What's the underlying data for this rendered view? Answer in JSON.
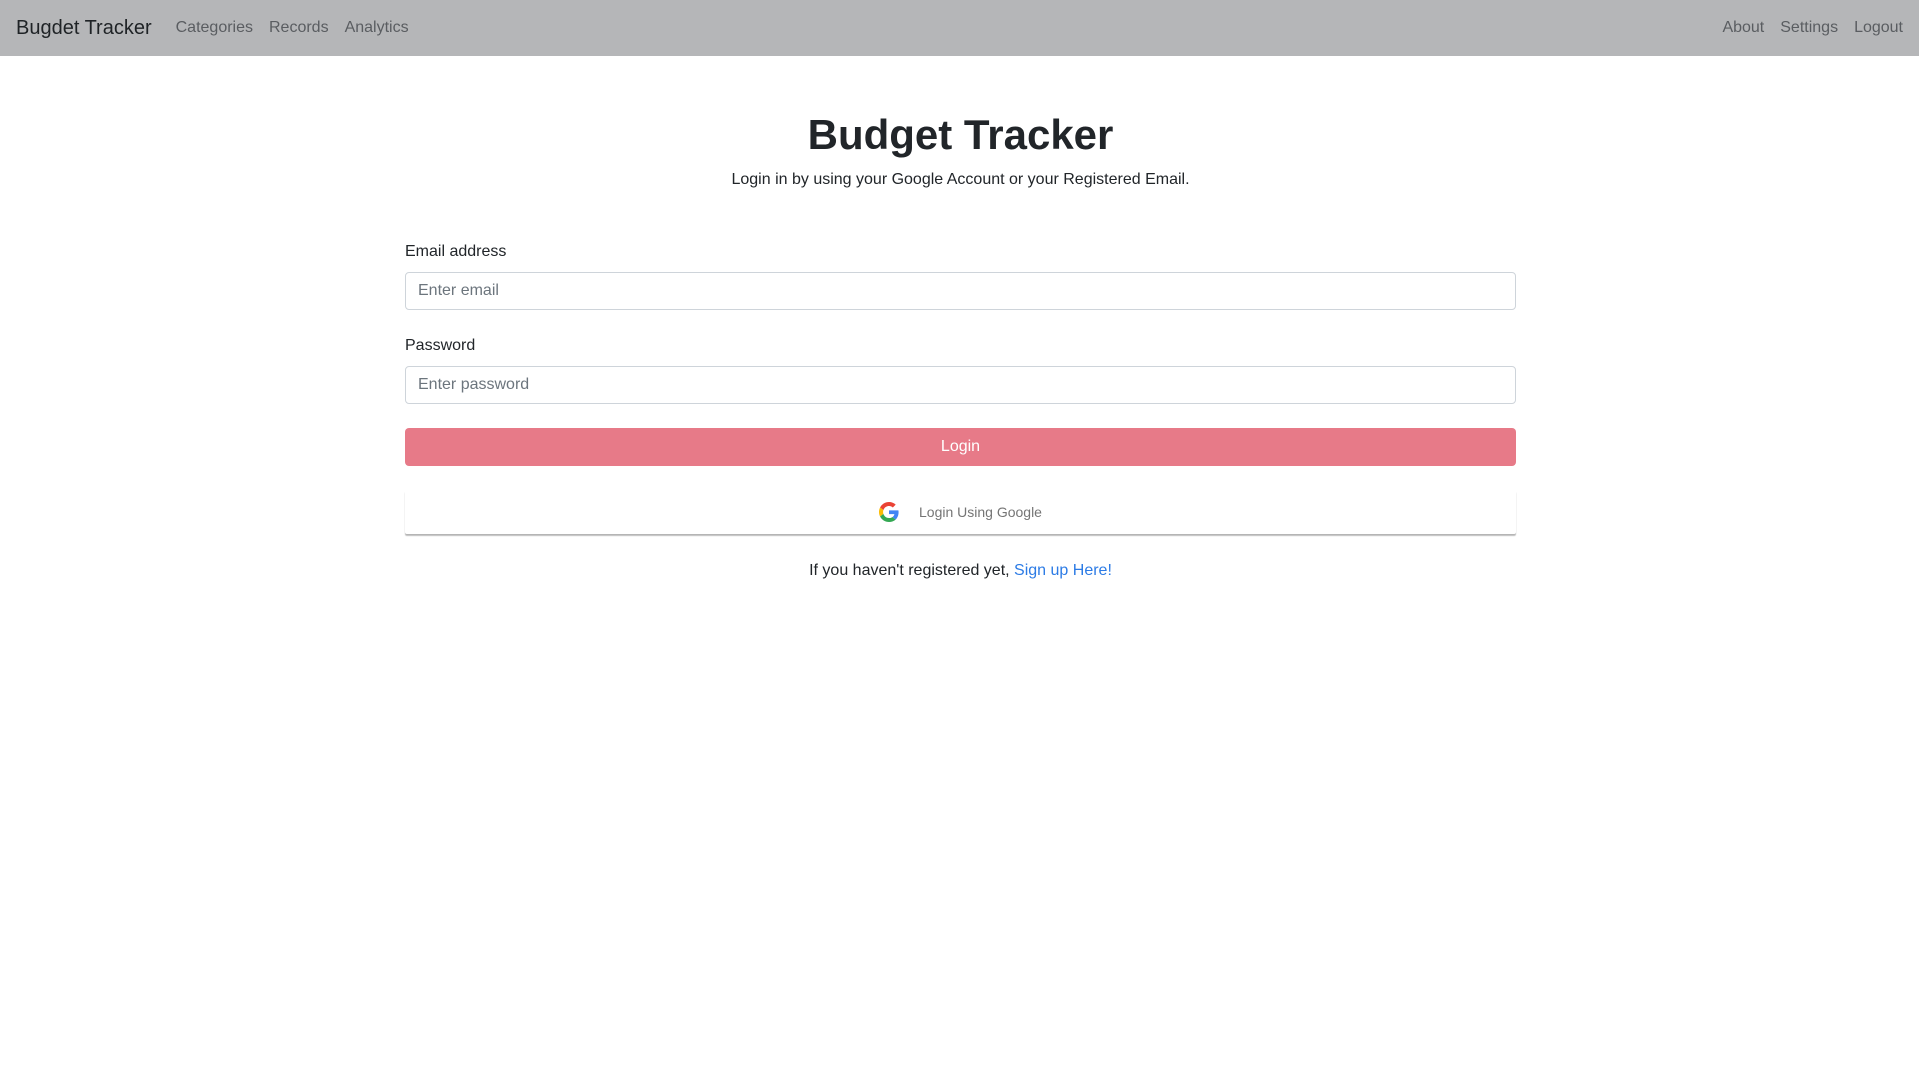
{
  "navbar": {
    "brand": "Bugdet Tracker",
    "left_links": [
      {
        "label": "Categories"
      },
      {
        "label": "Records"
      },
      {
        "label": "Analytics"
      }
    ],
    "right_links": [
      {
        "label": "About"
      },
      {
        "label": "Settings"
      },
      {
        "label": "Logout"
      }
    ],
    "background": "#b5b6b8"
  },
  "main": {
    "title": "Budget Tracker",
    "subtitle": "Login in by using your Google Account or your Registered Email.",
    "email": {
      "label": "Email address",
      "placeholder": "Enter email",
      "value": ""
    },
    "password": {
      "label": "Password",
      "placeholder": "Enter password",
      "value": ""
    },
    "login_button": {
      "label": "Login",
      "color": "#e77a88"
    },
    "google_button": {
      "label": "Login Using Google",
      "icon": "google-g-icon"
    },
    "signup": {
      "prefix": "If you haven't registered yet, ",
      "link_label": "Sign up Here!",
      "link_color": "#2c7be5"
    }
  }
}
